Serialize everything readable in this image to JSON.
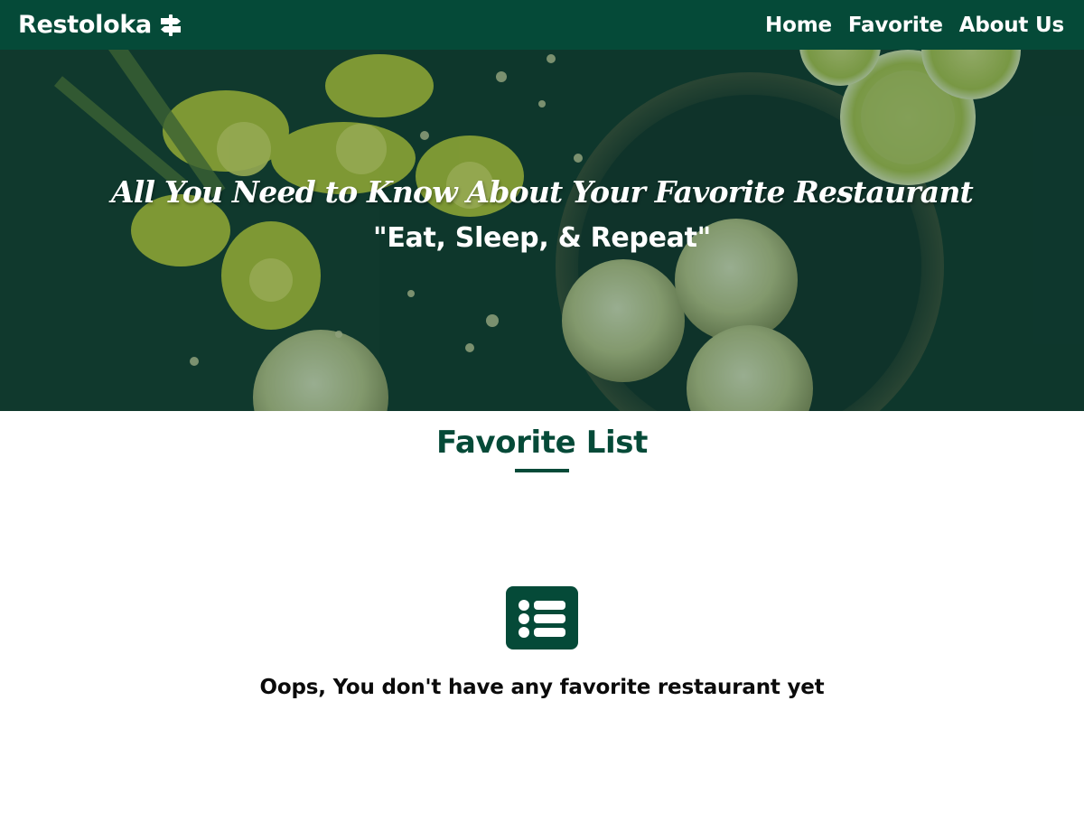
{
  "navbar": {
    "brand": "Restoloka",
    "brand_icon": "signpost-icon",
    "links": [
      "Home",
      "Favorite",
      "About Us"
    ],
    "background": "#054a38"
  },
  "hero": {
    "title": "All You Need to Know About Your Favorite Restaurant",
    "subtitle": "\"Eat, Sleep, & Repeat\""
  },
  "favorites": {
    "title": "Favorite List",
    "empty_icon": "list-icon",
    "empty_message": "Oops, You don't have any favorite restaurant yet"
  },
  "colors": {
    "primary": "#054a38",
    "text": "#0b0b0b"
  }
}
